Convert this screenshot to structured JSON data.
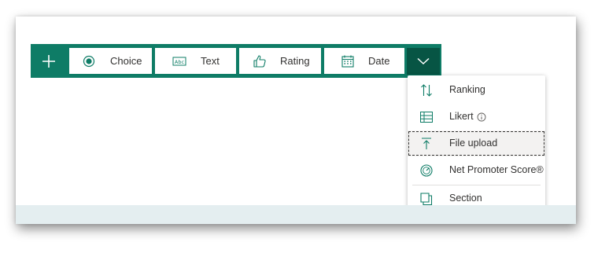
{
  "toolbar": {
    "add_icon": "plus-icon",
    "items": [
      {
        "label": "Choice",
        "icon": "radio-button-icon"
      },
      {
        "label": "Text",
        "icon": "abc-textbox-icon"
      },
      {
        "label": "Rating",
        "icon": "thumbs-up-icon"
      },
      {
        "label": "Date",
        "icon": "calendar-icon"
      }
    ],
    "more_icon": "chevron-down-icon"
  },
  "menu": {
    "items": [
      {
        "label": "Ranking",
        "icon": "sort-arrows-icon"
      },
      {
        "label": "Likert",
        "icon": "grid-table-icon",
        "info_icon": "info-icon"
      },
      {
        "label": "File upload",
        "icon": "upload-arrow-icon",
        "focused": true
      },
      {
        "label": "Net Promoter Score®",
        "icon": "gauge-icon"
      },
      {
        "label": "Section",
        "icon": "section-pages-icon"
      }
    ]
  },
  "colors": {
    "toolbar_bg": "#0e7c66",
    "more_button_bg": "#075544",
    "icon_color": "#0e7c66",
    "footer_band": "#e4eef0"
  }
}
